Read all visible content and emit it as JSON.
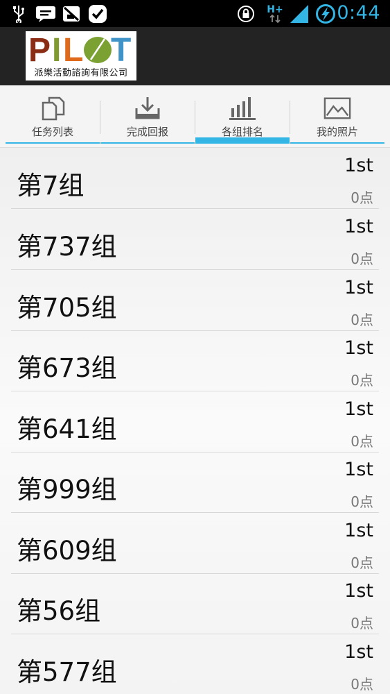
{
  "status_bar": {
    "time": "0:44",
    "network_label": "H+",
    "icons": [
      "usb-icon",
      "message-icon",
      "no-sim-icon",
      "check-icon",
      "lock-icon",
      "network-icon",
      "signal-icon",
      "battery-charging-icon"
    ],
    "accent_color": "#33b5e5"
  },
  "header": {
    "logo_word": "PILOT",
    "logo_subtitle": "派樂活動諮詢有限公司",
    "logo_colors": {
      "P": "#8b2c14",
      "I": "#7f9a2e",
      "L": "#e06a1b",
      "O": "#7aa132",
      "T": "#3f93c6"
    }
  },
  "tabs": [
    {
      "label": "任务列表",
      "icon": "documents-icon",
      "active": false
    },
    {
      "label": "完成回报",
      "icon": "download-icon",
      "active": false
    },
    {
      "label": "各组排名",
      "icon": "bar-chart-icon",
      "active": true
    },
    {
      "label": "我的照片",
      "icon": "picture-icon",
      "active": false
    }
  ],
  "rankings": [
    {
      "name": "第7组",
      "rank": "1st",
      "points": "0点"
    },
    {
      "name": "第737组",
      "rank": "1st",
      "points": "0点"
    },
    {
      "name": "第705组",
      "rank": "1st",
      "points": "0点"
    },
    {
      "name": "第673组",
      "rank": "1st",
      "points": "0点"
    },
    {
      "name": "第641组",
      "rank": "1st",
      "points": "0点"
    },
    {
      "name": "第999组",
      "rank": "1st",
      "points": "0点"
    },
    {
      "name": "第609组",
      "rank": "1st",
      "points": "0点"
    },
    {
      "name": "第56组",
      "rank": "1st",
      "points": "0点"
    },
    {
      "name": "第577组",
      "rank": "1st",
      "points": "0点"
    }
  ]
}
